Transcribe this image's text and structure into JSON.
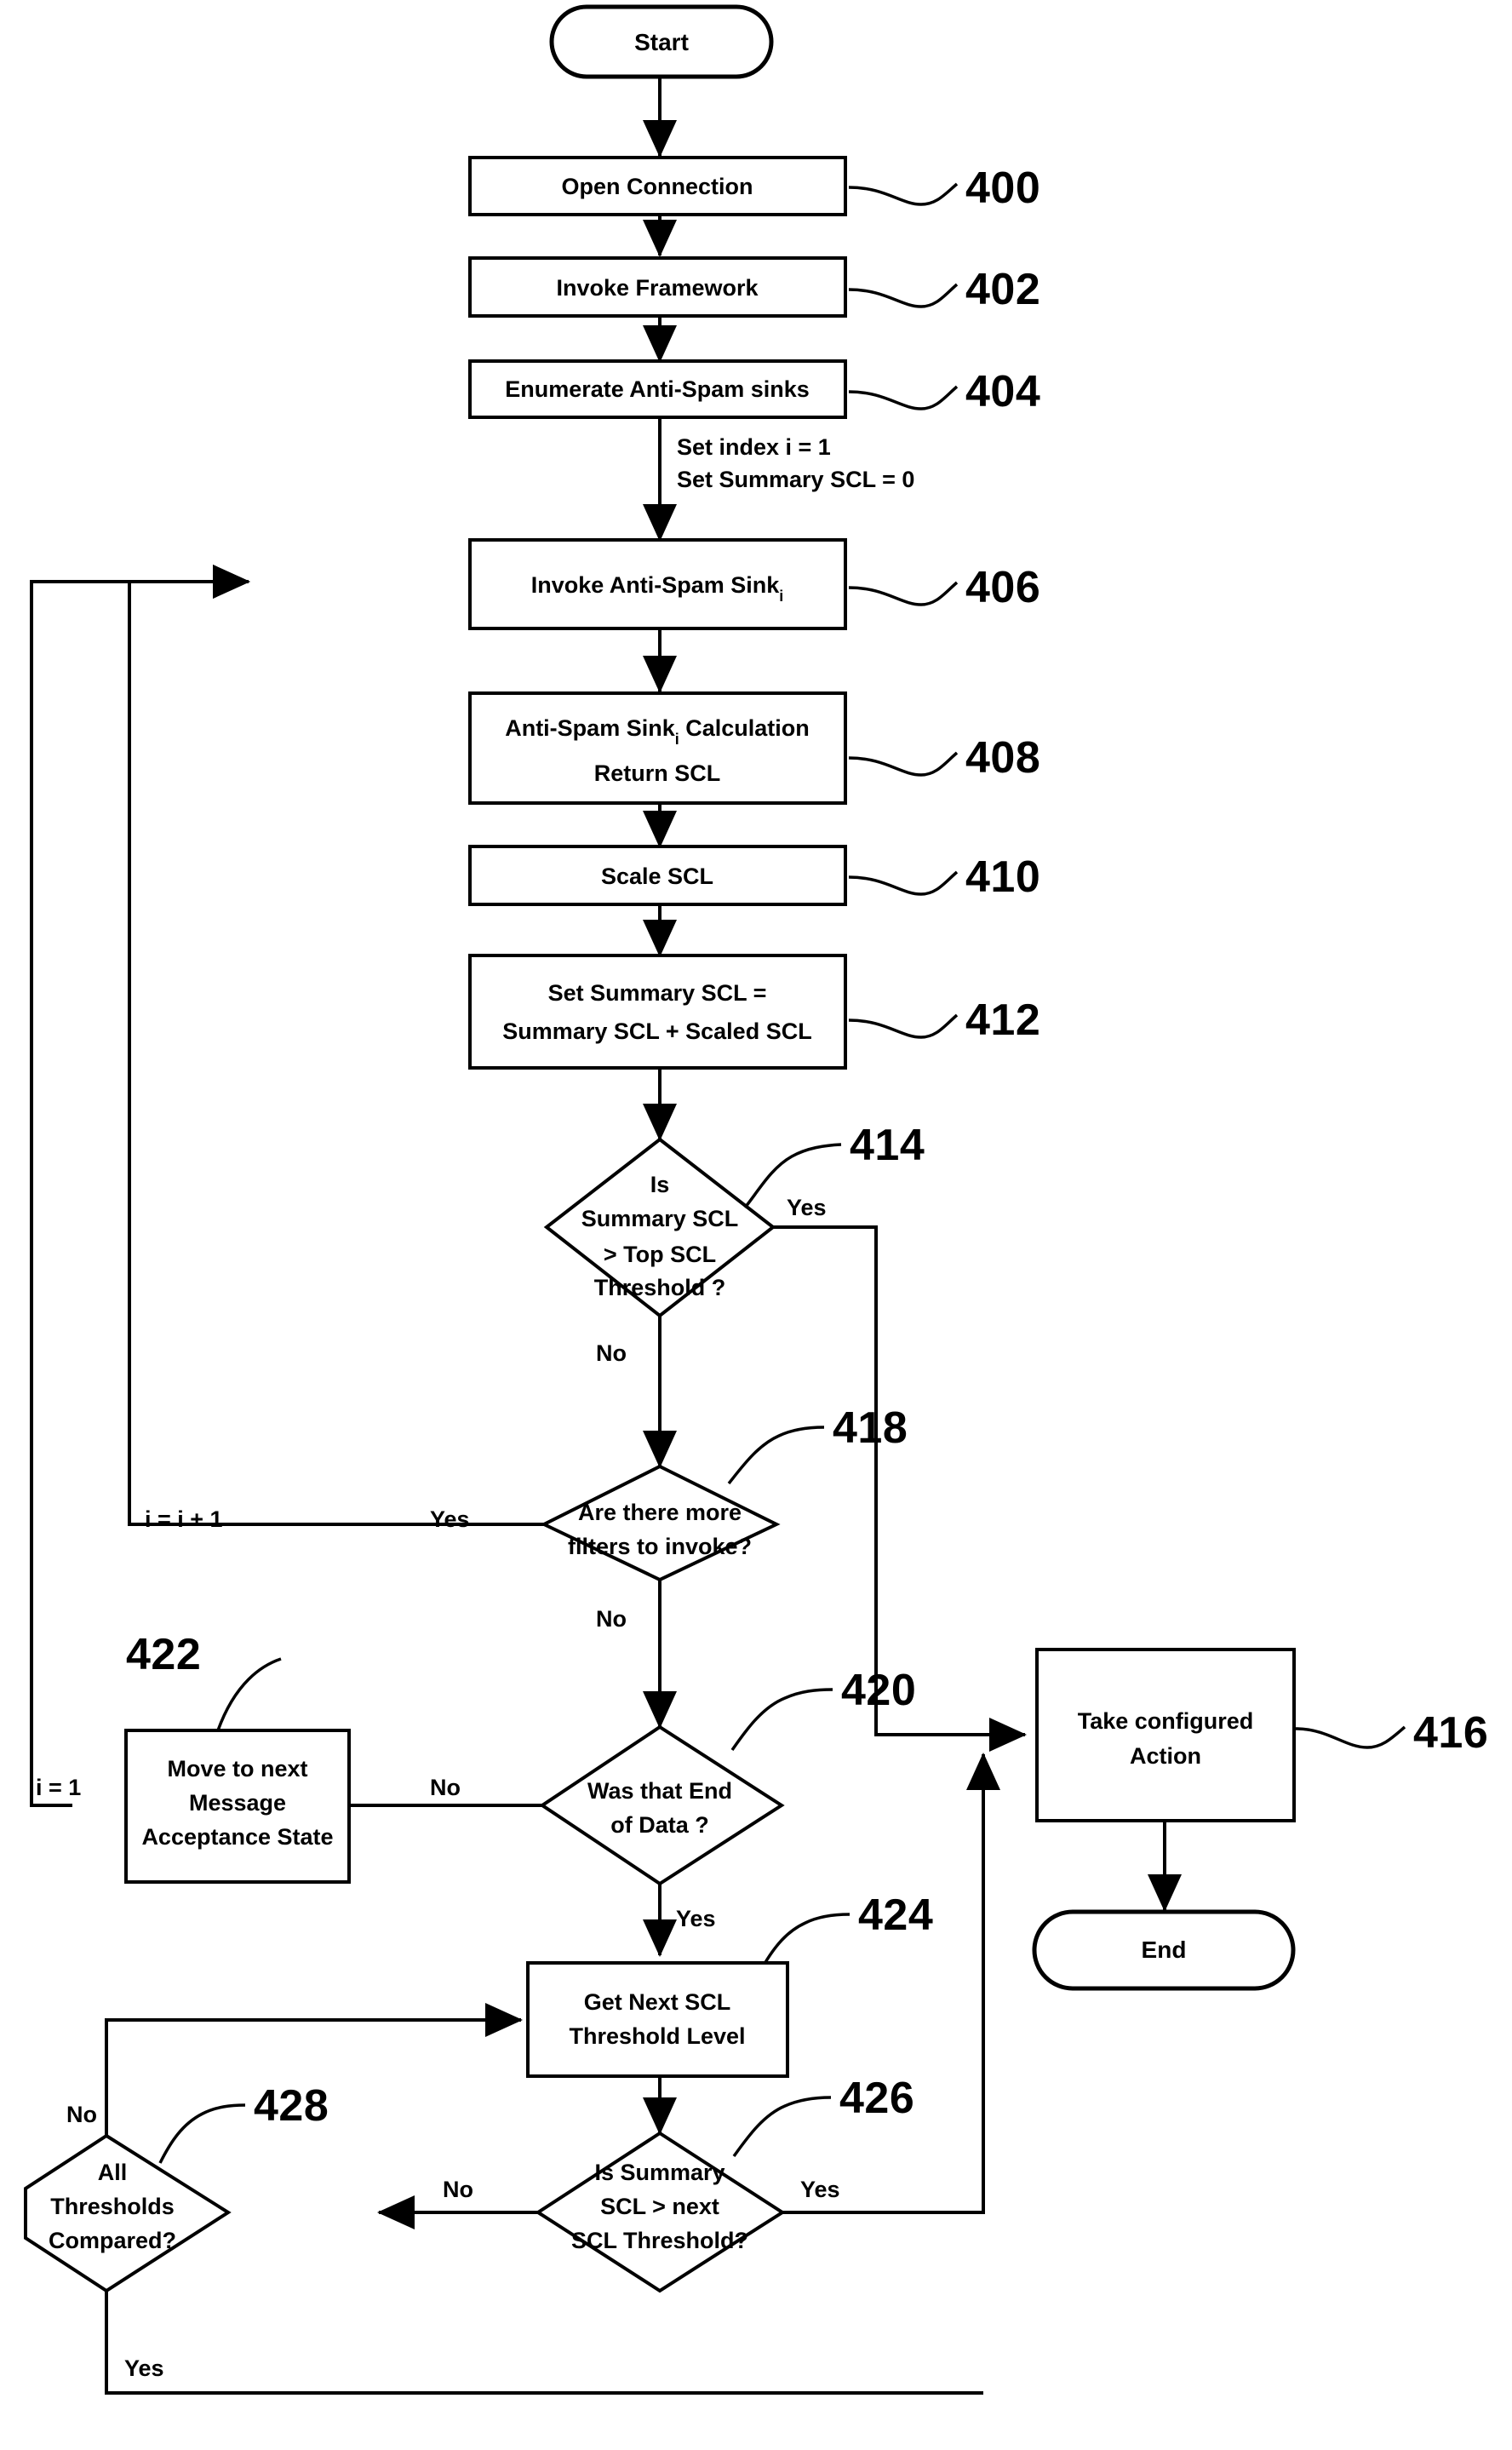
{
  "figure": {
    "type": "flowchart",
    "title": "Anti-Spam Sink SCL Evaluation Flowchart",
    "reference_numerals": [
      "400",
      "402",
      "404",
      "406",
      "408",
      "410",
      "412",
      "414",
      "416",
      "418",
      "420",
      "422",
      "424",
      "426",
      "428"
    ]
  },
  "nodes": {
    "start": {
      "label": "Start",
      "shape": "terminator"
    },
    "n400": {
      "label": "Open Connection",
      "shape": "process",
      "ref": "400"
    },
    "n402": {
      "label": "Invoke Framework",
      "shape": "process",
      "ref": "402"
    },
    "n404": {
      "label": "Enumerate Anti-Spam sinks",
      "shape": "process",
      "ref": "404"
    },
    "n406": {
      "label_main": "Invoke Anti-Spam Sink",
      "label_sub": "i",
      "shape": "process",
      "ref": "406"
    },
    "n408": {
      "label_line1_main": "Anti-Spam Sink",
      "label_line1_sub": "i",
      "label_line1_tail": " Calculation",
      "label_line2": "Return SCL",
      "shape": "process",
      "ref": "408"
    },
    "n410": {
      "label": "Scale SCL",
      "shape": "process",
      "ref": "410"
    },
    "n412": {
      "label_line1": "Set Summary SCL =",
      "label_line2": "Summary SCL + Scaled SCL",
      "shape": "process",
      "ref": "412"
    },
    "n414": {
      "label_line1": "Is",
      "label_line2": "Summary SCL",
      "label_line3": "> Top SCL",
      "label_line4": "Threshold ?",
      "shape": "decision",
      "ref": "414"
    },
    "n416": {
      "label_line1": "Take configured",
      "label_line2": "Action",
      "shape": "process",
      "ref": "416"
    },
    "n418": {
      "label_line1": "Are there more",
      "label_line2": "filters to invoke?",
      "shape": "decision",
      "ref": "418"
    },
    "n420": {
      "label_line1": "Was that End",
      "label_line2": "of Data ?",
      "shape": "decision",
      "ref": "420"
    },
    "n422": {
      "label_line1": "Move to next",
      "label_line2": "Message",
      "label_line3": "Acceptance State",
      "shape": "process",
      "ref": "422"
    },
    "n424": {
      "label_line1": "Get Next SCL",
      "label_line2": "Threshold Level",
      "shape": "process",
      "ref": "424"
    },
    "n426": {
      "label_line1": "Is Summary",
      "label_line2": "SCL > next",
      "label_line3": "SCL Threshold?",
      "shape": "decision",
      "ref": "426"
    },
    "n428": {
      "label_line1": "All",
      "label_line2": "Thresholds",
      "label_line3": "Compared?",
      "shape": "decision",
      "ref": "428"
    },
    "end": {
      "label": "End",
      "shape": "terminator"
    }
  },
  "annotations": {
    "init_line1": "Set index i = 1",
    "init_line2": "Set Summary SCL = 0",
    "increment_i": "i = i + 1",
    "reset_i": "i = 1"
  },
  "edge_labels": {
    "e414_yes": "Yes",
    "e414_no": "No",
    "e418_yes": "Yes",
    "e418_no": "No",
    "e420_no": "No",
    "e420_yes": "Yes",
    "e426_no": "No",
    "e426_yes": "Yes",
    "e428_no": "No",
    "e428_yes": "Yes"
  },
  "refs": {
    "r400": "400",
    "r402": "402",
    "r404": "404",
    "r406": "406",
    "r408": "408",
    "r410": "410",
    "r412": "412",
    "r414": "414",
    "r416": "416",
    "r418": "418",
    "r420": "420",
    "r422": "422",
    "r424": "424",
    "r426": "426",
    "r428": "428"
  },
  "colors": {
    "stroke": "#000000",
    "fill": "#ffffff",
    "background": "#ffffff"
  }
}
